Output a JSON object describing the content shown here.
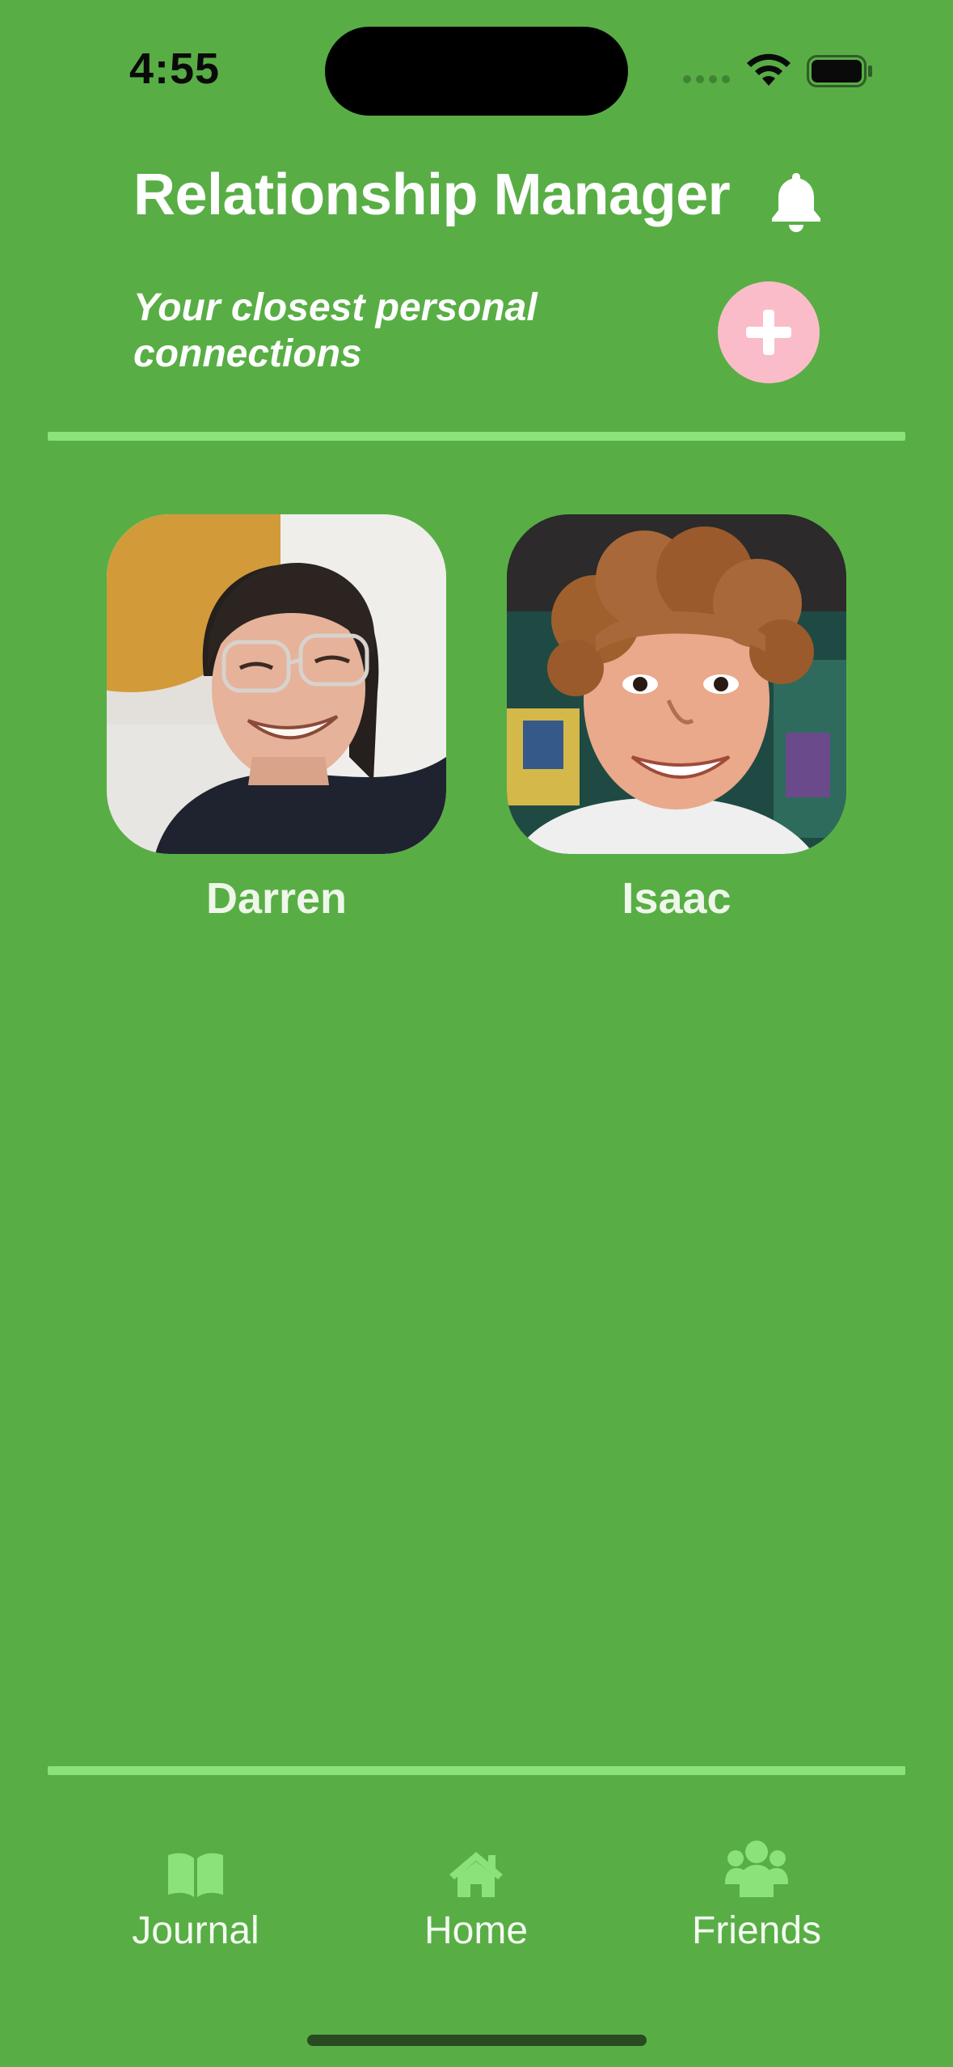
{
  "status_bar": {
    "time": "4:55"
  },
  "header": {
    "title": "Relationship Manager",
    "subtitle": "Your closest personal connections",
    "notification_icon": "bell-icon",
    "add_icon": "plus-icon"
  },
  "friends": [
    {
      "name": "Darren"
    },
    {
      "name": "Isaac"
    }
  ],
  "tab_bar": {
    "items": [
      {
        "label": "Journal",
        "icon": "book-icon"
      },
      {
        "label": "Home",
        "icon": "house-icon"
      },
      {
        "label": "Friends",
        "icon": "people-icon"
      }
    ]
  },
  "colors": {
    "background": "#58ae45",
    "accent_line": "#8be27a",
    "add_button": "#fbbcc9",
    "tab_icon": "#8be27a"
  }
}
